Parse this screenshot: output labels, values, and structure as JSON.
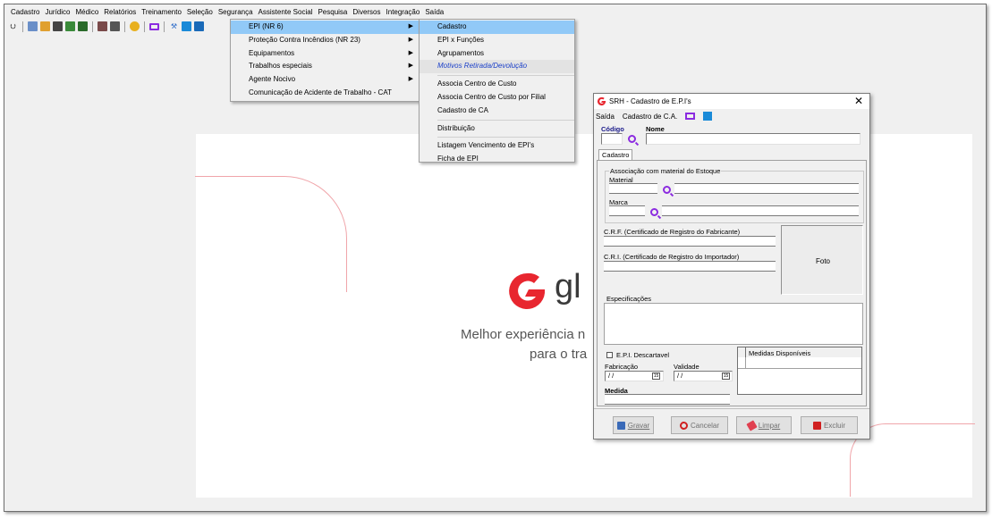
{
  "menubar": {
    "items": [
      "Cadastro",
      "Jurídico",
      "Médico",
      "Relatórios",
      "Treinamento",
      "Seleção",
      "Segurança",
      "Assistente Social",
      "Pesquisa",
      "Diversos",
      "Integração",
      "Saída"
    ]
  },
  "security_menu": {
    "items": [
      "EPI (NR 6)",
      "Proteção Contra Incêndios (NR 23)",
      "Equipamentos",
      "Trabalhos especiais",
      "Agente Nocivo",
      "Comunicação de Acidente de Trabalho - CAT"
    ]
  },
  "epi_submenu": {
    "items": [
      "Cadastro",
      "EPI x Funções",
      "Agrupamentos",
      "Motivos Retirada/Devolução",
      "Associa Centro de Custo",
      "Associa Centro de Custo por Filial",
      "Cadastro de CA",
      "Distribuição",
      "Listagem Vencimento de EPI's",
      "Ficha de EPI"
    ]
  },
  "background": {
    "logo_text": "gl",
    "tagline_1": "Melhor experiência n",
    "tagline_2": "para o tra"
  },
  "dialog": {
    "title": "SRH - Cadastro de E.P.I's",
    "close_glyph": "✕",
    "menu": {
      "saida": "Saída",
      "cadastro_ca": "Cadastro de C.A."
    },
    "codigo_label": "Código",
    "nome_label": "Nome",
    "tab_label": "Cadastro",
    "assoc_group_label": "Associação com material do Estoque",
    "material_label": "Material",
    "marca_label": "Marca",
    "crf_label": "C.R.F. (Certificado de Registro do Fabricante)",
    "cri_label": "C.R.I. (Certificado de Registro do Importador)",
    "foto_label": "Foto",
    "especificacoes_label": "Especificações",
    "descartavel_label": "E.P.I. Descartavel",
    "fabricacao_label": "Fabricação",
    "validade_label": "Validade",
    "fabricacao_value": "/  /",
    "validade_value": "/  /",
    "medida_label": "Medida",
    "medidas_header": "Medidas Disponíveis",
    "buttons": {
      "gravar": "Gravar",
      "cancelar": "Cancelar",
      "limpar": "Limpar",
      "excluir": "Excluir"
    }
  },
  "colors": {
    "menu_highlight": "#91c9f7",
    "brand_red": "#e8262f",
    "lookup_purple": "#8b2be0",
    "link_blue": "#1a3fc8"
  }
}
